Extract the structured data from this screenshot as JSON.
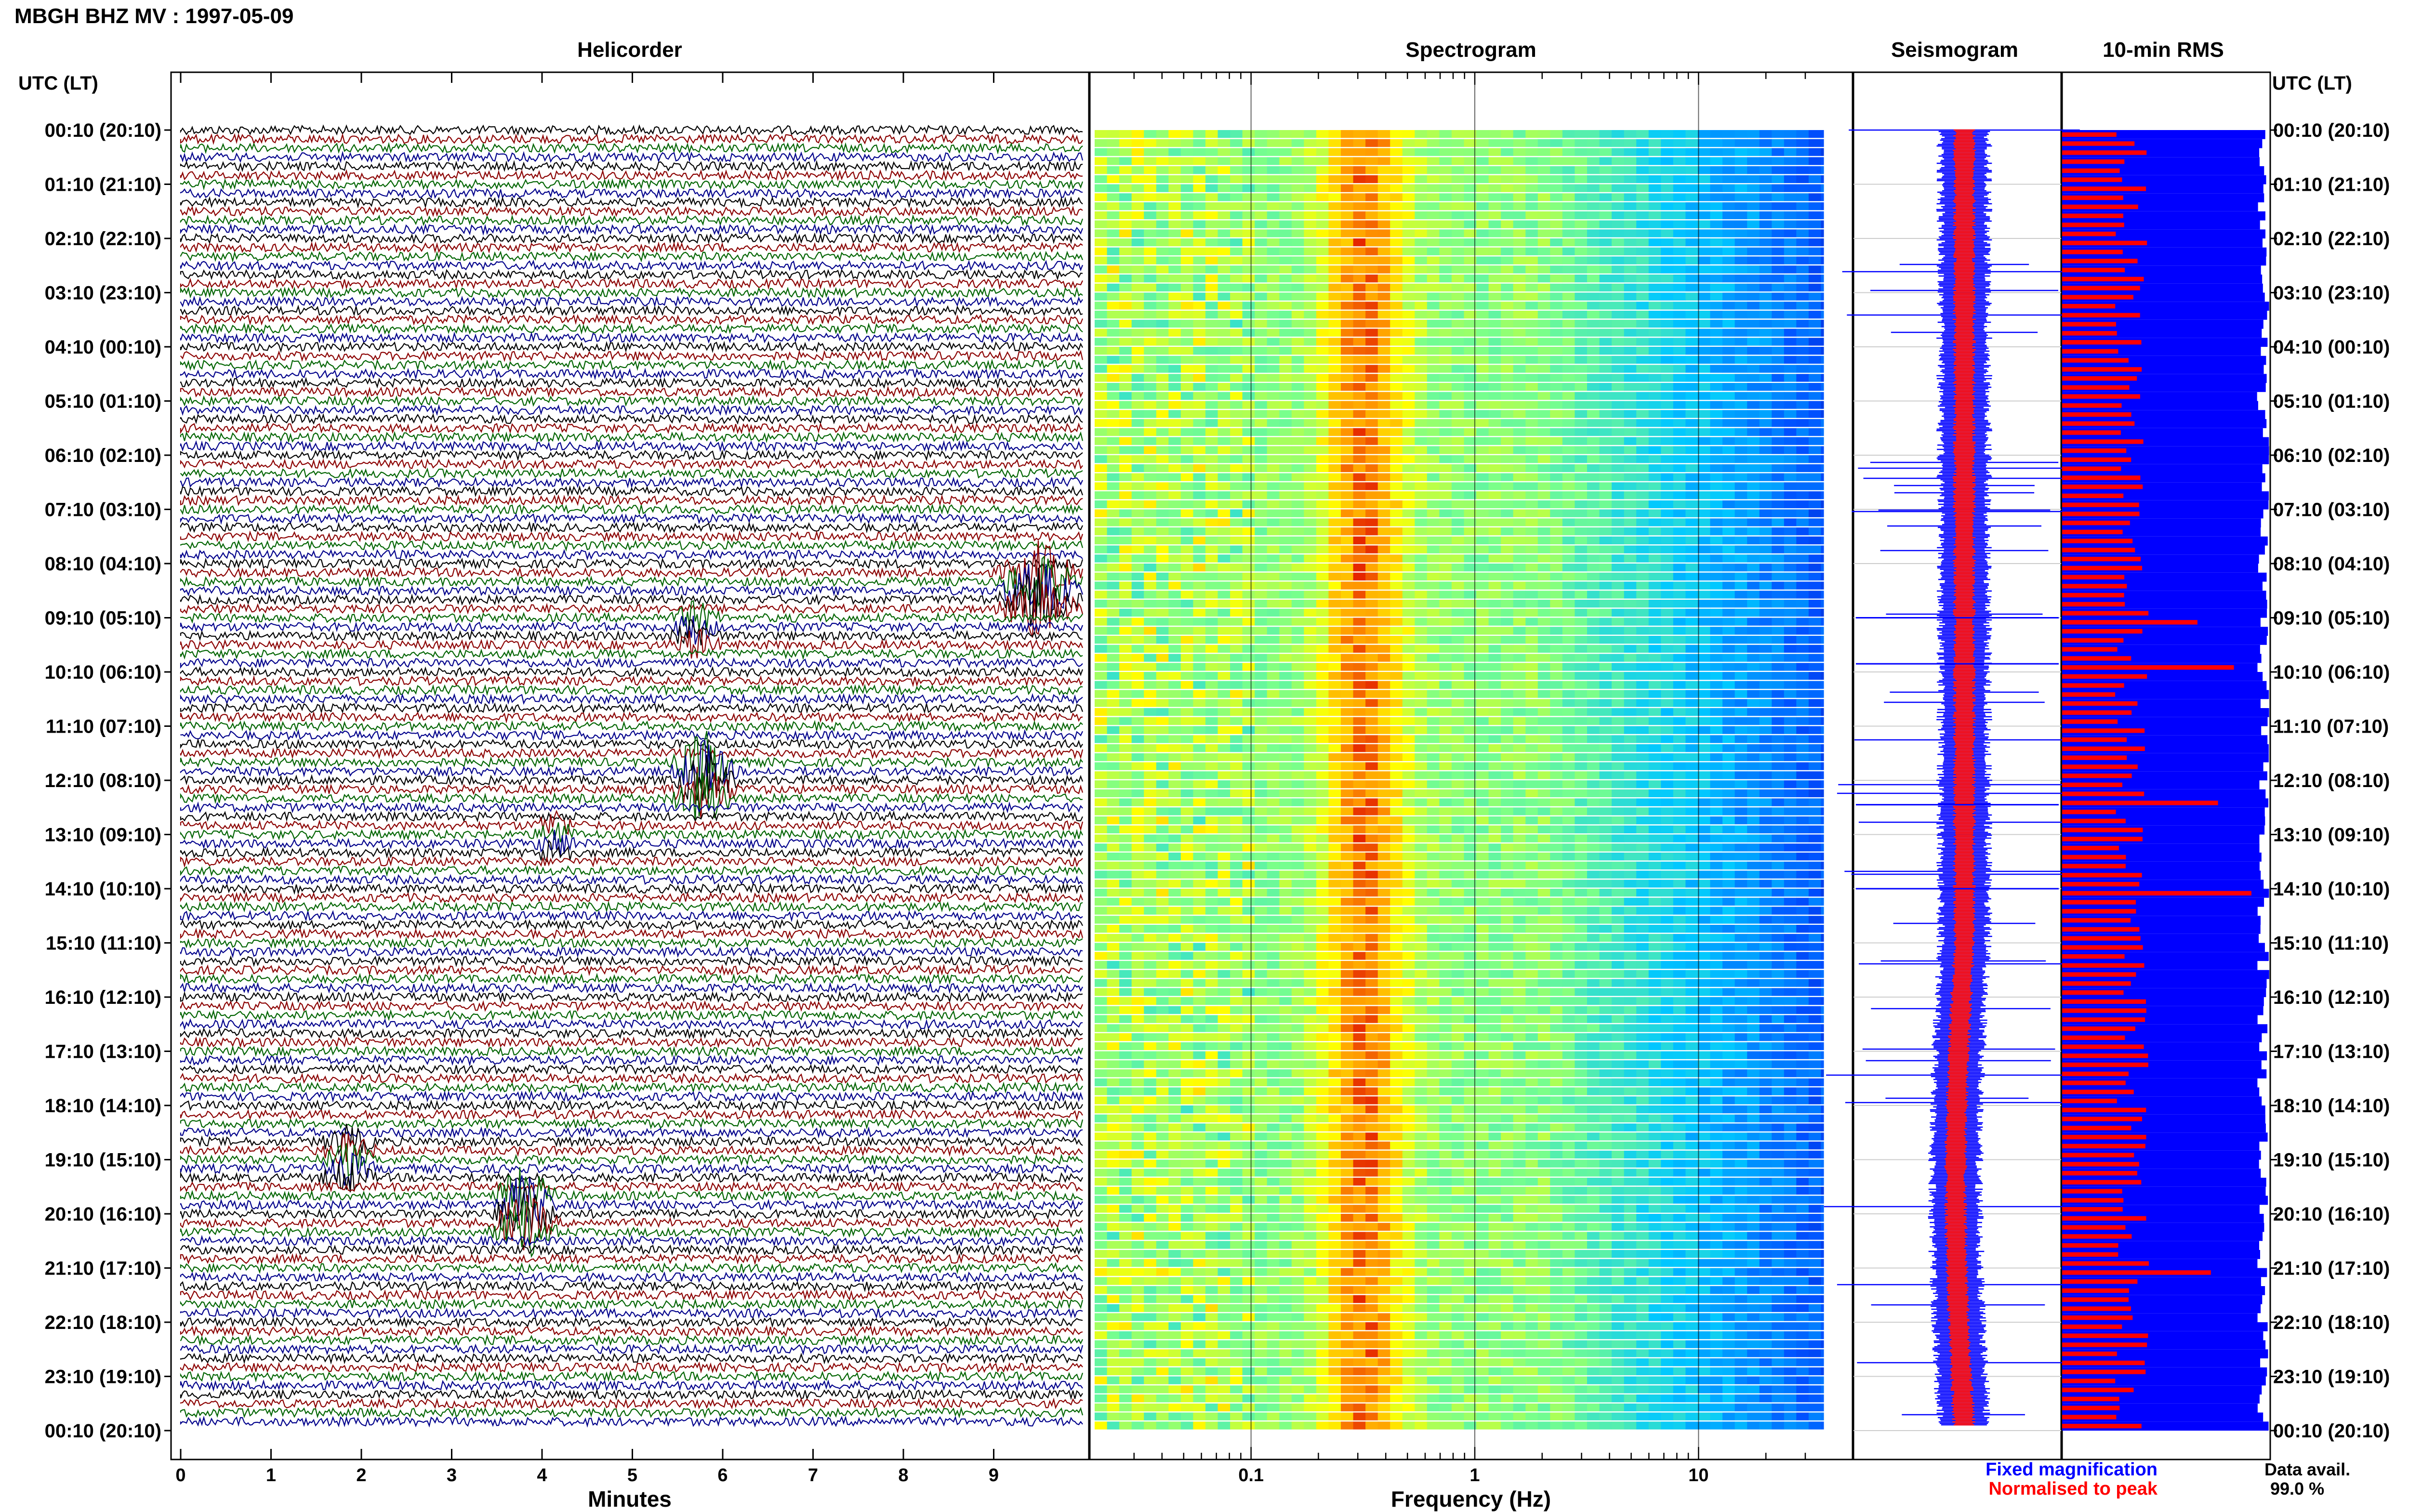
{
  "header": {
    "title": "MBGH BHZ MV : 1997-05-09",
    "utc_label_left": "UTC (LT)",
    "utc_label_right": "UTC (LT)"
  },
  "panels": {
    "helicorder": "Helicorder",
    "spectrogram": "Spectrogram",
    "seismogram": "Seismogram",
    "rms": "10-min RMS"
  },
  "axes": {
    "minutes_label": "Minutes",
    "frequency_label": "Frequency (Hz)",
    "minute_ticks": [
      "0",
      "1",
      "2",
      "3",
      "4",
      "5",
      "6",
      "7",
      "8",
      "9"
    ],
    "frequency_ticks": [
      "0.1",
      "1",
      "10"
    ]
  },
  "time_labels": [
    "00:10 (20:10)",
    "01:10 (21:10)",
    "02:10 (22:10)",
    "03:10 (23:10)",
    "04:10 (00:10)",
    "05:10 (01:10)",
    "06:10 (02:10)",
    "07:10 (03:10)",
    "08:10 (04:10)",
    "09:10 (05:10)",
    "10:10 (06:10)",
    "11:10 (07:10)",
    "12:10 (08:10)",
    "13:10 (09:10)",
    "14:10 (10:10)",
    "15:10 (11:10)",
    "16:10 (12:10)",
    "17:10 (13:10)",
    "18:10 (14:10)",
    "19:10 (15:10)",
    "20:10 (16:10)",
    "21:10 (17:10)",
    "22:10 (18:10)",
    "23:10 (19:10)",
    "00:10 (20:10)"
  ],
  "legend": {
    "fixed": "Fixed magnification",
    "normalised": "Normalised to peak",
    "fixed_color": "#0000ff",
    "normalised_color": "#ff0000"
  },
  "data_avail": {
    "label": "Data avail.",
    "value": "99.0 %"
  },
  "colors": {
    "trace_cycle": [
      "#000000",
      "#8b0000",
      "#006400",
      "#00008b"
    ],
    "rms_blue": "#0000ff",
    "rms_red": "#ff0000"
  },
  "chart_data": [
    {
      "type": "line",
      "title": "Helicorder",
      "xlabel": "Minutes",
      "xlim": [
        0,
        10
      ],
      "rows_per_hour": 6,
      "note_rows": "144 ten-minute traces, colours cycle black/red/green/blue",
      "events": [
        {
          "hour": 8.5,
          "minute_start": 9.0,
          "minute_end": 10.0,
          "amplitude": "high"
        },
        {
          "hour": 9.2,
          "minute_start": 5.4,
          "minute_end": 6.0,
          "amplitude": "medium"
        },
        {
          "hour": 12.0,
          "minute_start": 5.4,
          "minute_end": 6.2,
          "amplitude": "high"
        },
        {
          "hour": 13.1,
          "minute_start": 3.9,
          "minute_end": 4.4,
          "amplitude": "medium"
        },
        {
          "hour": 19.0,
          "minute_start": 1.5,
          "minute_end": 2.2,
          "amplitude": "medium"
        },
        {
          "hour": 20.0,
          "minute_start": 3.4,
          "minute_end": 4.2,
          "amplitude": "high"
        }
      ]
    },
    {
      "type": "heatmap",
      "title": "Spectrogram",
      "xlabel": "Frequency (Hz)",
      "xscale": "log",
      "xlim": [
        0.02,
        40
      ],
      "peak_band_hz": [
        0.2,
        0.5
      ]
    },
    {
      "type": "bar",
      "title": "10-min RMS",
      "series": [
        {
          "name": "Fixed magnification",
          "color": "#0000ff"
        },
        {
          "name": "Normalised to peak",
          "color": "#ff0000"
        }
      ],
      "notable_peaks_hour": [
        9.0,
        9.8,
        12.4,
        14.0,
        21.0
      ]
    }
  ]
}
